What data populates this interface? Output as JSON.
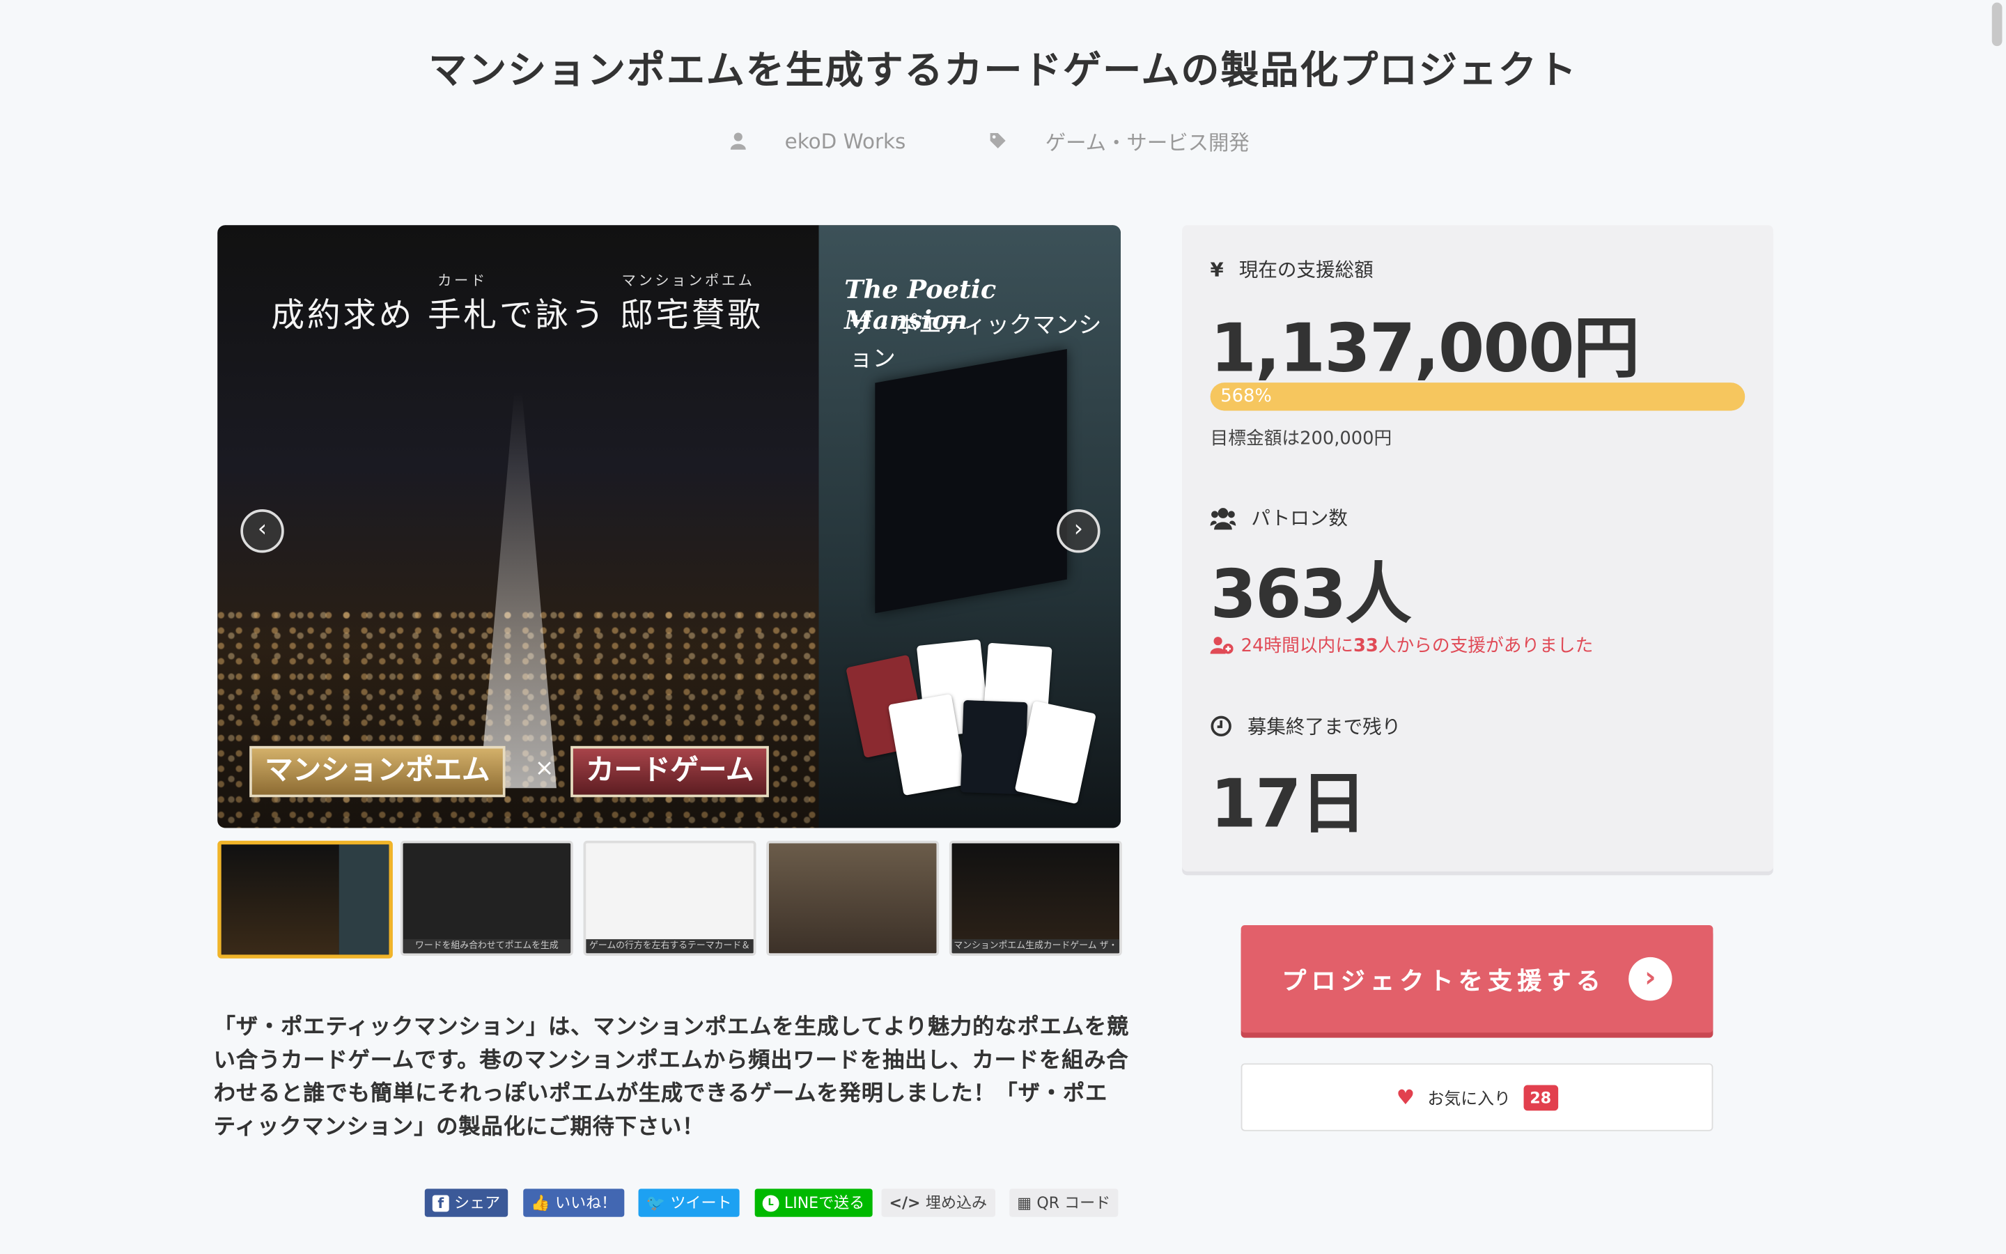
{
  "title": "マンションポエムを生成するカードゲームの製品化プロジェクト",
  "meta": {
    "author": "ekoD Works",
    "category": "ゲーム・サービス開発"
  },
  "hero": {
    "headline": "成約求め 手札で詠う 邸宅賛歌",
    "ruby_card": "カード",
    "ruby_poem": "マンションポエム",
    "title_en": "The Poetic Mansion",
    "title_ja": "ザ・ポエティックマンション",
    "badge_left": "マンションポエム",
    "times": "×",
    "badge_right": "カードゲーム",
    "prev": "‹",
    "next": "›"
  },
  "thumbs": [
    {
      "caption": ""
    },
    {
      "caption": "ワードを組み合わせてポエムを生成"
    },
    {
      "caption": "ゲームの行方を左右するテーマカード＆アクションカード"
    },
    {
      "caption": ""
    },
    {
      "caption": "マンションポエム生成カードゲーム ザ・ポエティックマンション"
    }
  ],
  "description": "「ザ・ポエティックマンション」は、マンションポエムを生成してより魅力的なポエムを競い合うカードゲームです。巷のマンションポエムから頻出ワードを抽出し、カードを組み合わせると誰でも簡単にそれっぽいポエムが生成できるゲームを発明しました！「ザ・ポエティックマンション」の製品化にご期待下さい！",
  "share": {
    "facebook": "シェア",
    "like": "いいね！",
    "tweet": "ツイート",
    "line": "LINEで送る",
    "embed": "埋め込み",
    "qr": "QR コード"
  },
  "stats": {
    "funding_label": "現在の支援総額",
    "funding_amount": "1,137,000円",
    "percent": "568%",
    "percent_value": 568,
    "goal": "目標金額は200,000円",
    "patrons_label": "パトロン数",
    "patrons": "363人",
    "recent_prefix": "24時間以内に",
    "recent_count": "33",
    "recent_suffix": "人からの支援がありました",
    "remaining_label": "募集終了まで残り",
    "remaining": "17日"
  },
  "support_button": "プロジェクトを支援する",
  "favorite": {
    "label": "お気に入り",
    "count": "28"
  },
  "colors": {
    "accent": "#e2606a",
    "progress": "#f6c65e",
    "favorite_badge": "#e2404e"
  }
}
